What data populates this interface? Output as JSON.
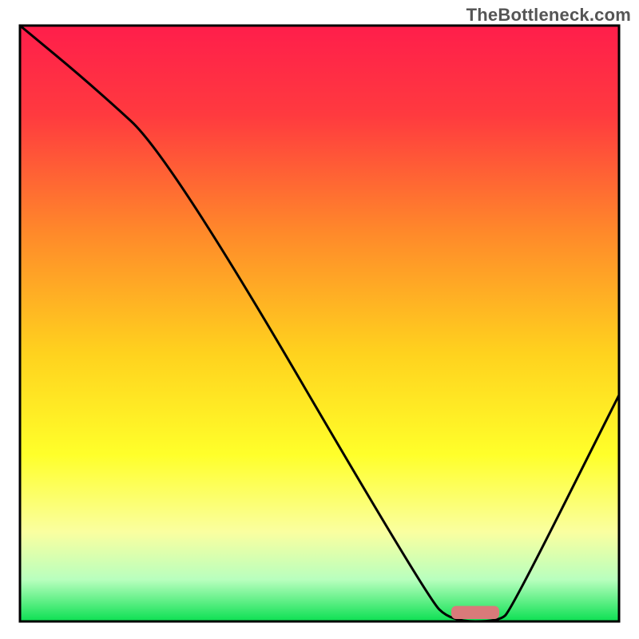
{
  "watermark": "TheBottleneck.com",
  "chart_data": {
    "type": "line",
    "title": "",
    "xlabel": "",
    "ylabel": "",
    "xlim": [
      0,
      100
    ],
    "ylim": [
      0,
      100
    ],
    "series": [
      {
        "name": "bottleneck-curve",
        "x": [
          0,
          12,
          25,
          68,
          72,
          80,
          82,
          100
        ],
        "values": [
          100,
          90,
          78,
          4,
          0,
          0,
          2,
          38
        ]
      }
    ],
    "marker": {
      "name": "highlight-bar",
      "x_from": 72,
      "x_to": 80,
      "y": 1.5,
      "thickness": 2.2,
      "color": "#d97a7a"
    },
    "background_gradient": {
      "stops": [
        {
          "offset": 0.0,
          "color": "#ff1e4b"
        },
        {
          "offset": 0.15,
          "color": "#ff3a3f"
        },
        {
          "offset": 0.35,
          "color": "#ff8a2a"
        },
        {
          "offset": 0.55,
          "color": "#ffd21e"
        },
        {
          "offset": 0.72,
          "color": "#ffff2a"
        },
        {
          "offset": 0.85,
          "color": "#faffa0"
        },
        {
          "offset": 0.93,
          "color": "#b8ffbe"
        },
        {
          "offset": 1.0,
          "color": "#0be052"
        }
      ]
    },
    "frame_color": "#000000",
    "line_color": "#000000",
    "line_width": 3
  }
}
